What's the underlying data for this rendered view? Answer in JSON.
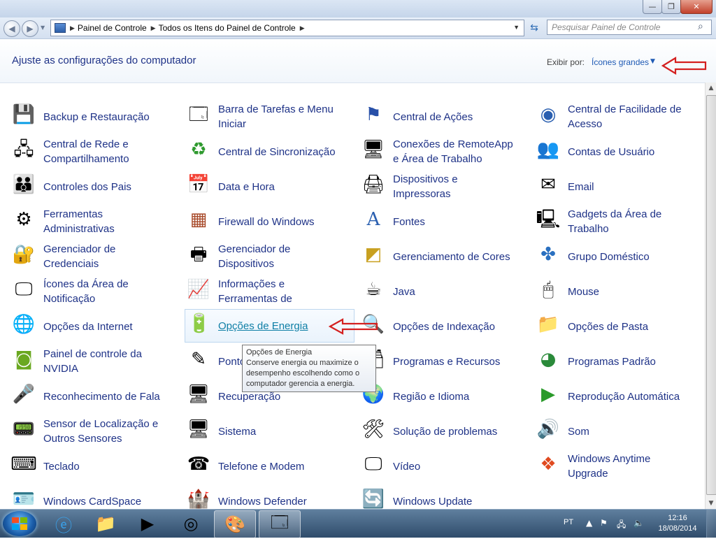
{
  "window": {
    "minimize_glyph": "—",
    "maximize_glyph": "❐",
    "close_glyph": "✕"
  },
  "address_bar": {
    "segments": [
      "Painel de Controle",
      "Todos os Itens do Painel de Controle"
    ],
    "search_placeholder": "Pesquisar Painel de Controle"
  },
  "header": {
    "title": "Ajuste as configurações do computador",
    "view_by_label": "Exibir por:",
    "view_by_value": "Ícones grandes"
  },
  "items": [
    {
      "label": "Backup e Restauração",
      "icon": "backup-icon"
    },
    {
      "label": "Barra de Tarefas e Menu Iniciar",
      "icon": "taskbar-icon"
    },
    {
      "label": "Central de Ações",
      "icon": "flag-icon"
    },
    {
      "label": "Central de Facilidade de Acesso",
      "icon": "accessibility-icon"
    },
    {
      "label": "Central de Rede e Compartilhamento",
      "icon": "network-icon"
    },
    {
      "label": "Central de Sincronização",
      "icon": "sync-icon"
    },
    {
      "label": "Conexões de RemoteApp e Área de Trabalho",
      "icon": "remoteapp-icon"
    },
    {
      "label": "Contas de Usuário",
      "icon": "users-icon"
    },
    {
      "label": "Controles dos Pais",
      "icon": "parental-icon"
    },
    {
      "label": "Data e Hora",
      "icon": "calendar-icon"
    },
    {
      "label": "Dispositivos e Impressoras",
      "icon": "printer-icon"
    },
    {
      "label": "Email",
      "icon": "mail-icon"
    },
    {
      "label": "Ferramentas Administrativas",
      "icon": "admin-tools-icon"
    },
    {
      "label": "Firewall do Windows",
      "icon": "firewall-icon"
    },
    {
      "label": "Fontes",
      "icon": "fonts-icon"
    },
    {
      "label": "Gadgets da Área de Trabalho",
      "icon": "gadgets-icon"
    },
    {
      "label": "Gerenciador de Credenciais",
      "icon": "credentials-icon"
    },
    {
      "label": "Gerenciador de Dispositivos",
      "icon": "device-manager-icon"
    },
    {
      "label": "Gerenciamento de Cores",
      "icon": "color-icon"
    },
    {
      "label": "Grupo Doméstico",
      "icon": "homegroup-icon"
    },
    {
      "label": "Ícones da Área de Notificação",
      "icon": "notification-icon"
    },
    {
      "label": "Informações e Ferramentas de Desempenho",
      "icon": "performance-icon"
    },
    {
      "label": "Java",
      "icon": "java-icon"
    },
    {
      "label": "Mouse",
      "icon": "mouse-icon"
    },
    {
      "label": "Opções da Internet",
      "icon": "internet-icon"
    },
    {
      "label": "Opções de Energia",
      "icon": "power-icon"
    },
    {
      "label": "Opções de Indexação",
      "icon": "indexing-icon"
    },
    {
      "label": "Opções de Pasta",
      "icon": "folder-options-icon"
    },
    {
      "label": "Painel de controle da NVIDIA",
      "icon": "nvidia-icon"
    },
    {
      "label": "Ponto",
      "icon": "pen-icon"
    },
    {
      "label": "Programas e Recursos",
      "icon": "programs-icon"
    },
    {
      "label": "Programas Padrão",
      "icon": "default-programs-icon"
    },
    {
      "label": "Reconhecimento de Fala",
      "icon": "microphone-icon"
    },
    {
      "label": "Recuperação",
      "icon": "recovery-icon"
    },
    {
      "label": "Região e Idioma",
      "icon": "region-icon"
    },
    {
      "label": "Reprodução Automática",
      "icon": "autoplay-icon"
    },
    {
      "label": "Sensor de Localização e Outros Sensores",
      "icon": "sensor-icon"
    },
    {
      "label": "Sistema",
      "icon": "system-icon"
    },
    {
      "label": "Solução de problemas",
      "icon": "troubleshoot-icon"
    },
    {
      "label": "Som",
      "icon": "speaker-icon"
    },
    {
      "label": "Teclado",
      "icon": "keyboard-icon"
    },
    {
      "label": "Telefone e Modem",
      "icon": "phone-icon"
    },
    {
      "label": "Vídeo",
      "icon": "display-icon"
    },
    {
      "label": "Windows Anytime Upgrade",
      "icon": "windows-logo-icon"
    },
    {
      "label": "Windows CardSpace",
      "icon": "cardspace-icon"
    },
    {
      "label": "Windows Defender",
      "icon": "defender-icon"
    },
    {
      "label": "Windows Update",
      "icon": "update-icon"
    }
  ],
  "tooltip": {
    "title": "Opções de Energia",
    "body": "Conserve energia ou maximize o desempenho escolhendo como o computador gerencia a energia."
  },
  "taskbar": {
    "apps": [
      "internet-explorer-icon",
      "explorer-folder-icon",
      "media-player-icon",
      "chrome-icon",
      "paint-icon",
      "control-panel-icon"
    ],
    "language": "PT",
    "time": "12:16",
    "date": "18/08/2014"
  },
  "colors": {
    "link": "#1e3287",
    "accent_red": "#d42020"
  }
}
